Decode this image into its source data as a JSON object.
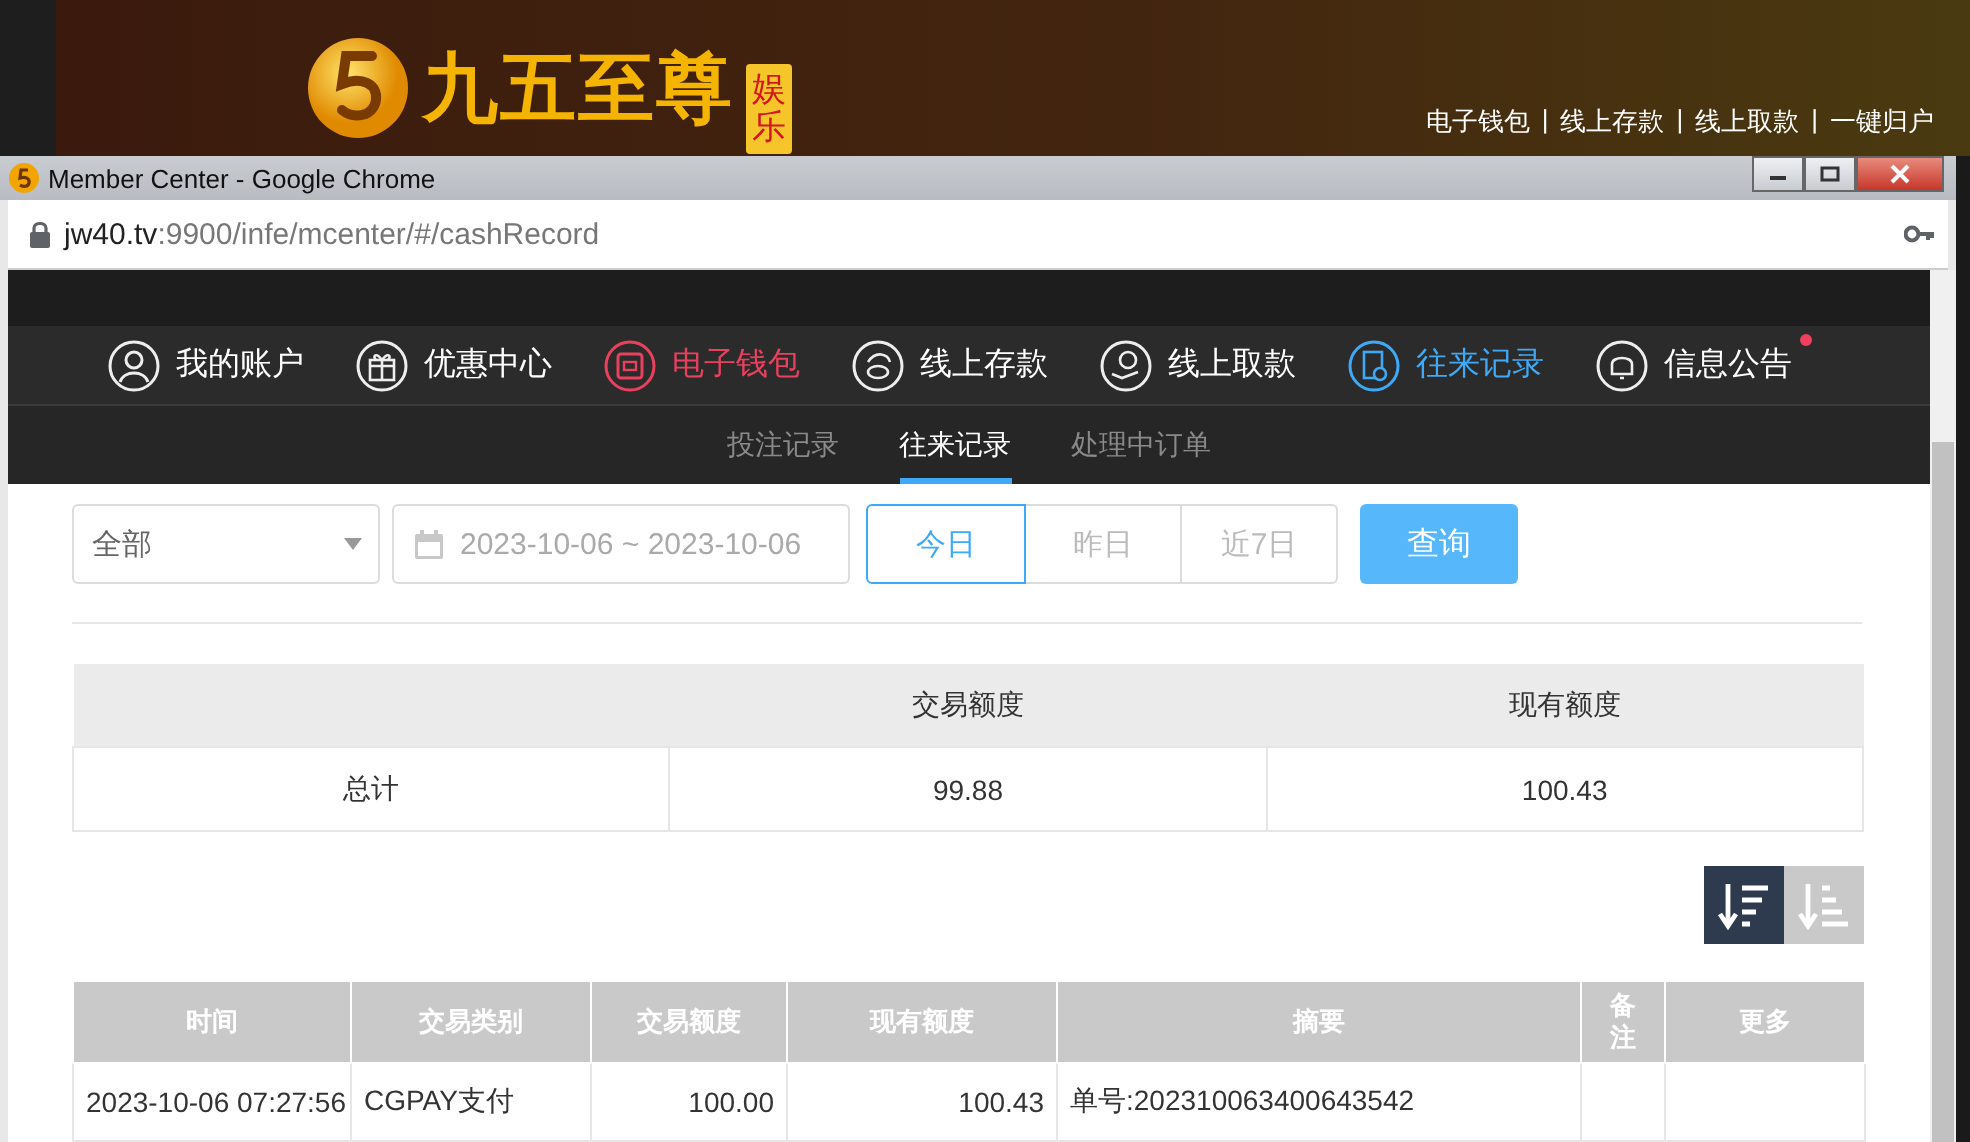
{
  "background_site": {
    "logo_text": "九五至尊",
    "logo_tag": "娱乐",
    "links": [
      {
        "label": "电子钱包",
        "separator": "|"
      },
      {
        "label": "线上存款",
        "separator": "|"
      },
      {
        "label": "线上取款",
        "separator": "|"
      },
      {
        "label": "一键归户"
      }
    ]
  },
  "browser": {
    "title": "Member Center - Google Chrome",
    "url_host": "jw40.tv",
    "url_path": ":9900/infe/mcenter/#/cashRecord"
  },
  "nav": {
    "items": [
      {
        "label": "我的账户",
        "color": "#ffffff",
        "dot": false
      },
      {
        "label": "优惠中心",
        "color": "#ffffff",
        "dot": false
      },
      {
        "label": "电子钱包",
        "color": "#e8415e",
        "dot": false
      },
      {
        "label": "线上存款",
        "color": "#ffffff",
        "dot": false
      },
      {
        "label": "线上取款",
        "color": "#ffffff",
        "dot": false
      },
      {
        "label": "往来记录",
        "color": "#3fa9f5",
        "dot": false
      },
      {
        "label": "信息公告",
        "color": "#ffffff",
        "dot": true
      }
    ]
  },
  "sub_tabs": [
    {
      "label": "投注记录",
      "selected": false
    },
    {
      "label": "往来记录",
      "selected": true
    },
    {
      "label": "处理中订单",
      "selected": false
    }
  ],
  "filters": {
    "type_select": {
      "value": "全部"
    },
    "date_range": {
      "value": "2023-10-06 ~ 2023-10-06"
    },
    "quick_ranges": [
      {
        "label": "今日",
        "selected": true
      },
      {
        "label": "昨日",
        "selected": false
      },
      {
        "label": "近7日",
        "selected": false
      }
    ],
    "query_button": "查询"
  },
  "summary": {
    "columns": [
      "",
      "交易额度",
      "现有额度"
    ],
    "rows": [
      [
        "总计",
        "99.88",
        "100.43"
      ]
    ]
  },
  "sort_buttons": [
    {
      "selected": true
    },
    {
      "selected": false
    }
  ],
  "records": {
    "columns": [
      "时间",
      "交易类别",
      "交易额度",
      "现有额度",
      "摘要",
      "备注",
      "更多"
    ],
    "rows": [
      [
        "2023-10-06 07:27:56",
        "CGPAY支付",
        "100.00",
        "100.43",
        "单号:202310063400643542"
      ]
    ]
  }
}
